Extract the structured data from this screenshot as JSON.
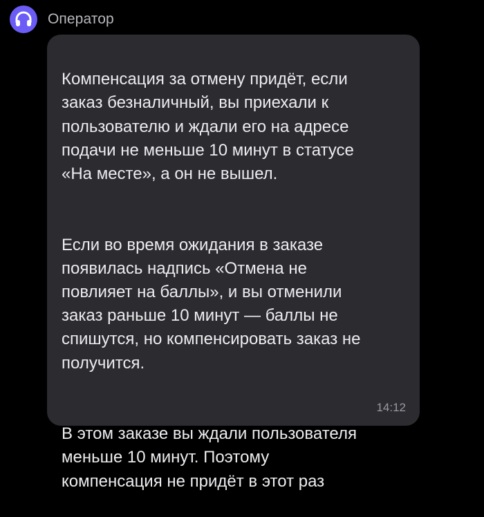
{
  "chat": {
    "sender_name": "Оператор",
    "avatar_icon": "headphones-icon",
    "avatar_color": "#6a5cf5",
    "message": {
      "paragraphs": [
        "Компенсация за отмену придёт, если\nзаказ безналичный, вы приехали к\nпользователю и ждали его на адресе\nподачи не меньше 10 минут в статусе\n«На месте», а он не вышел.",
        "Если во время ожидания в заказе\nпоявилась надпись «Отмена не\nповлияет на баллы», и вы отменили\nзаказ раньше 10 минут — баллы не\nспишутся, но компенсировать заказ не\nполучится.",
        "В этом заказе вы ждали пользователя\nменьше 10 минут. Поэтому\nкомпенсация не придёт в этот раз"
      ],
      "time": "14:12"
    }
  }
}
